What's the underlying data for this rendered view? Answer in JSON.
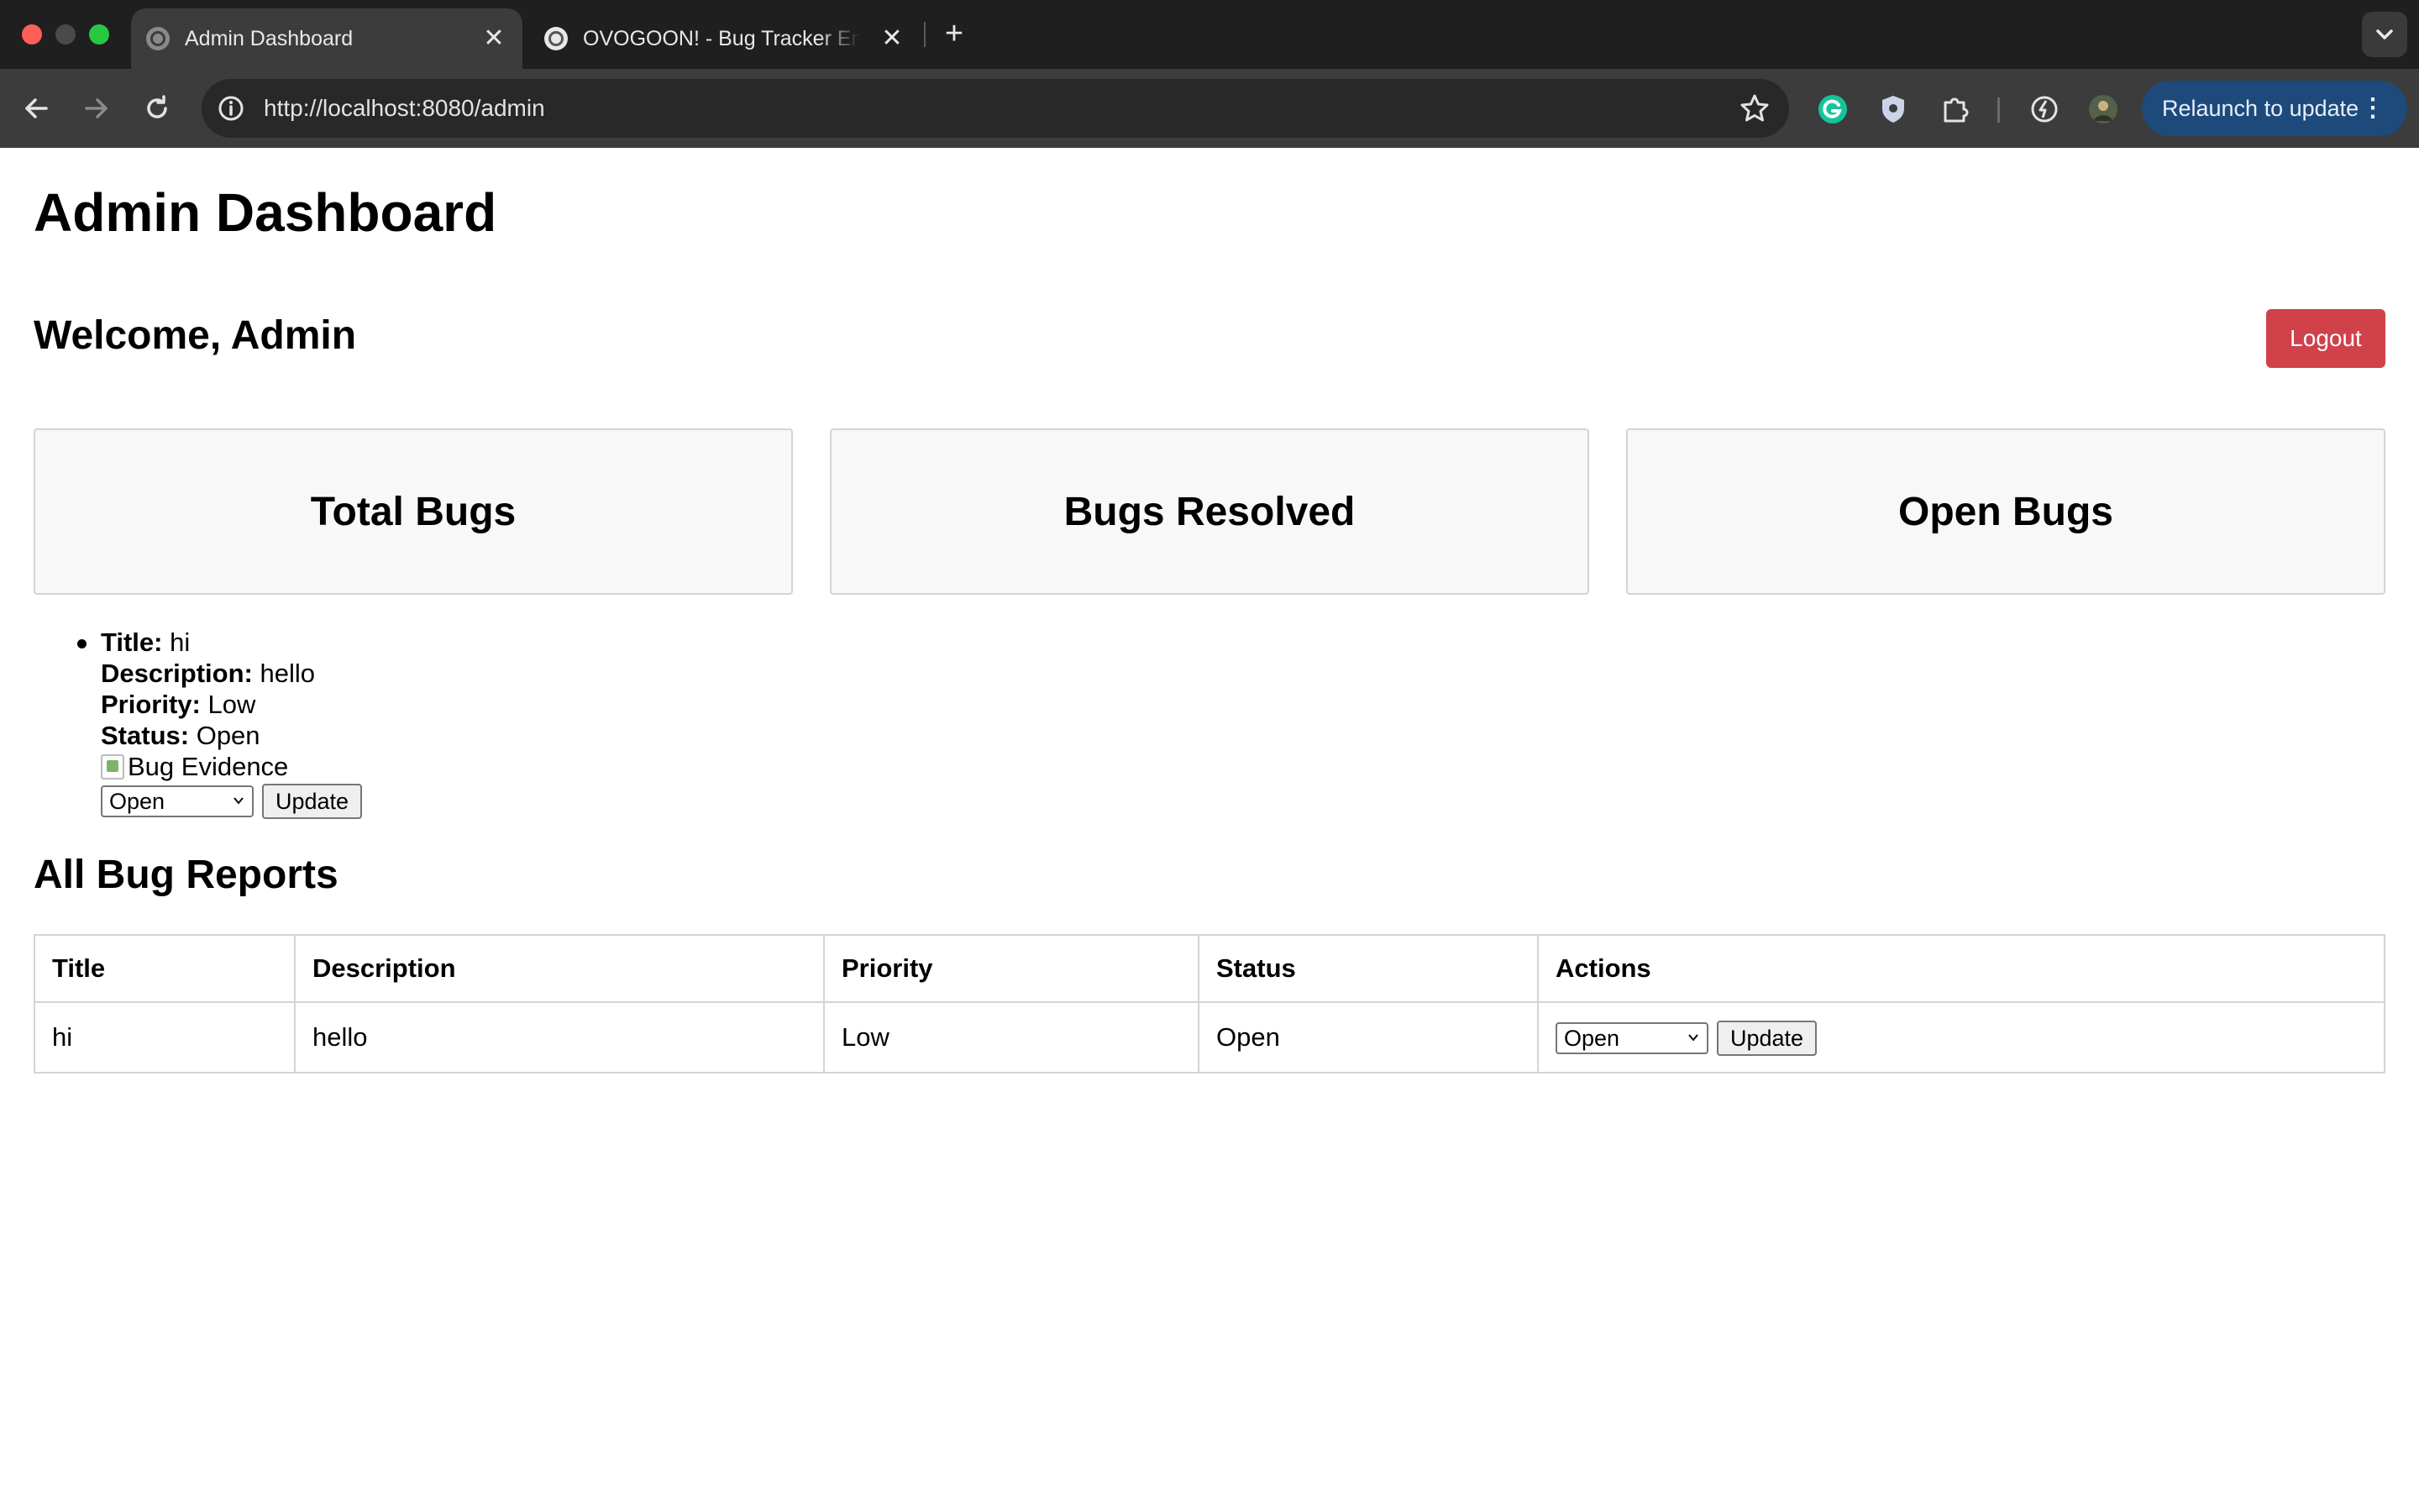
{
  "browser": {
    "tabs": [
      {
        "title": "Admin Dashboard",
        "active": true
      },
      {
        "title": "OVOGOON! - Bug Tracker En",
        "active": false
      }
    ],
    "new_tab_label": "+",
    "url": "http://localhost:8080/admin",
    "relaunch_label": "Relaunch to update",
    "close_glyph": "✕"
  },
  "page": {
    "title": "Admin Dashboard",
    "welcome": "Welcome, Admin",
    "logout_label": "Logout",
    "cards": [
      "Total Bugs",
      "Bugs Resolved",
      "Open Bugs"
    ],
    "bug_item": {
      "title_label": "Title:",
      "title": "hi",
      "description_label": "Description:",
      "description": "hello",
      "priority_label": "Priority:",
      "priority": "Low",
      "status_label": "Status:",
      "status": "Open",
      "image_alt": "Bug Evidence",
      "select_value": "Open",
      "update_label": "Update"
    },
    "reports_heading": "All Bug Reports",
    "table": {
      "headers": [
        "Title",
        "Description",
        "Priority",
        "Status",
        "Actions"
      ],
      "rows": [
        {
          "title": "hi",
          "description": "hello",
          "priority": "Low",
          "status": "Open",
          "select_value": "Open",
          "update_label": "Update"
        }
      ]
    }
  },
  "colors": {
    "logout": "#d0414a",
    "relaunch": "#1d4a7a",
    "card_bg": "#f8f8f8"
  }
}
